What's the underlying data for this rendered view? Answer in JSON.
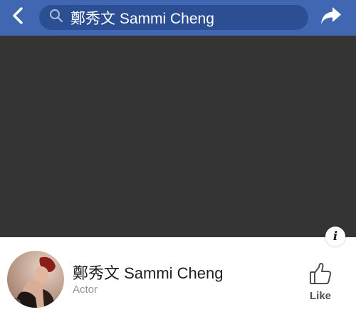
{
  "header": {
    "search_query": "鄭秀文 Sammi Cheng"
  },
  "profile": {
    "name": "鄭秀文 Sammi Cheng",
    "category": "Actor",
    "like_label": "Like",
    "info_label": "i"
  },
  "colors": {
    "header_bg": "#4267b2",
    "search_bg": "#2c4f93",
    "cover_bg": "#343434",
    "secondary_text": "#90949c"
  }
}
